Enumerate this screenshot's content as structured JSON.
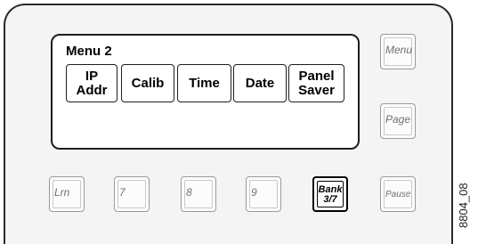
{
  "display": {
    "title": "Menu 2",
    "softkeys": [
      {
        "label": "IP\nAddr"
      },
      {
        "label": "Calib"
      },
      {
        "label": "Time"
      },
      {
        "label": "Date"
      },
      {
        "label": "Panel\nSaver"
      }
    ]
  },
  "side_buttons": {
    "menu": "Menu",
    "page": "Page",
    "pause": "Pause"
  },
  "bottom_buttons": {
    "lrn": "Lrn",
    "seven": "7",
    "eight": "8",
    "nine": "9",
    "bank": "Bank\n3/7"
  },
  "figure_id": "8804_08"
}
